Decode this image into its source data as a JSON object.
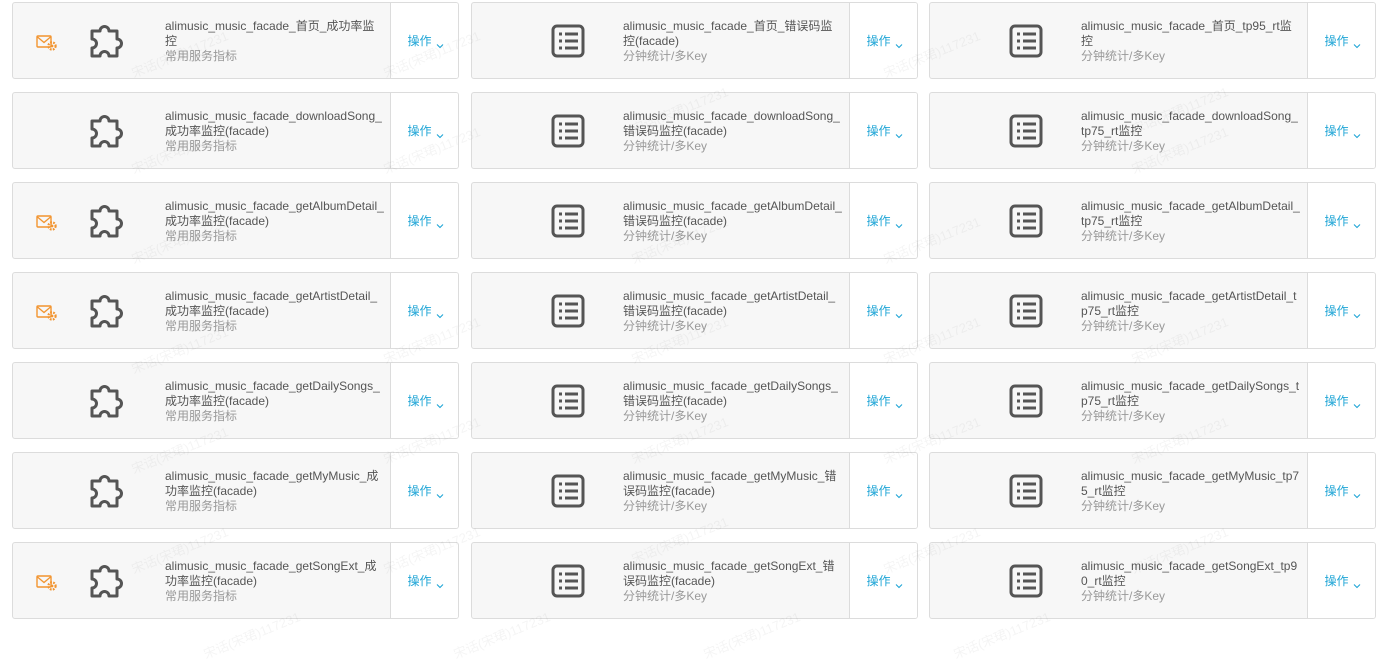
{
  "colors": {
    "accent": "#1ea5d6",
    "alert": "#f2942f",
    "icon": "#555555"
  },
  "watermark": "宋话(宋珺)117231",
  "cards": [
    {
      "name": "alimusic_music_facade_首页_成功率监控",
      "sub": "常用服务指标",
      "op": "操作",
      "kind": "service",
      "alert": true
    },
    {
      "name": "alimusic_music_facade_首页_错误码监控(facade)",
      "sub": "分钟统计/多Key",
      "op": "操作",
      "kind": "stat",
      "alert": false
    },
    {
      "name": "alimusic_music_facade_首页_tp95_rt监控",
      "sub": "分钟统计/多Key",
      "op": "操作",
      "kind": "stat",
      "alert": false
    },
    {
      "name": "alimusic_music_facade_downloadSong_成功率监控(facade)",
      "sub": "常用服务指标",
      "op": "操作",
      "kind": "service",
      "alert": false
    },
    {
      "name": "alimusic_music_facade_downloadSong_错误码监控(facade)",
      "sub": "分钟统计/多Key",
      "op": "操作",
      "kind": "stat",
      "alert": false
    },
    {
      "name": "alimusic_music_facade_downloadSong_tp75_rt监控",
      "sub": "分钟统计/多Key",
      "op": "操作",
      "kind": "stat",
      "alert": false
    },
    {
      "name": "alimusic_music_facade_getAlbumDetail_成功率监控(facade)",
      "sub": "常用服务指标",
      "op": "操作",
      "kind": "service",
      "alert": true
    },
    {
      "name": "alimusic_music_facade_getAlbumDetail_错误码监控(facade)",
      "sub": "分钟统计/多Key",
      "op": "操作",
      "kind": "stat",
      "alert": false
    },
    {
      "name": "alimusic_music_facade_getAlbumDetail_tp75_rt监控",
      "sub": "分钟统计/多Key",
      "op": "操作",
      "kind": "stat",
      "alert": false
    },
    {
      "name": "alimusic_music_facade_getArtistDetail_成功率监控(facade)",
      "sub": "常用服务指标",
      "op": "操作",
      "kind": "service",
      "alert": true
    },
    {
      "name": "alimusic_music_facade_getArtistDetail_错误码监控(facade)",
      "sub": "分钟统计/多Key",
      "op": "操作",
      "kind": "stat",
      "alert": false
    },
    {
      "name": "alimusic_music_facade_getArtistDetail_tp75_rt监控",
      "sub": "分钟统计/多Key",
      "op": "操作",
      "kind": "stat",
      "alert": false
    },
    {
      "name": "alimusic_music_facade_getDailySongs_成功率监控(facade)",
      "sub": "常用服务指标",
      "op": "操作",
      "kind": "service",
      "alert": false
    },
    {
      "name": "alimusic_music_facade_getDailySongs_错误码监控(facade)",
      "sub": "分钟统计/多Key",
      "op": "操作",
      "kind": "stat",
      "alert": false
    },
    {
      "name": "alimusic_music_facade_getDailySongs_tp75_rt监控",
      "sub": "分钟统计/多Key",
      "op": "操作",
      "kind": "stat",
      "alert": false
    },
    {
      "name": "alimusic_music_facade_getMyMusic_成功率监控(facade)",
      "sub": "常用服务指标",
      "op": "操作",
      "kind": "service",
      "alert": false
    },
    {
      "name": "alimusic_music_facade_getMyMusic_错误码监控(facade)",
      "sub": "分钟统计/多Key",
      "op": "操作",
      "kind": "stat",
      "alert": false
    },
    {
      "name": "alimusic_music_facade_getMyMusic_tp75_rt监控",
      "sub": "分钟统计/多Key",
      "op": "操作",
      "kind": "stat",
      "alert": false
    },
    {
      "name": "alimusic_music_facade_getSongExt_成功率监控(facade)",
      "sub": "常用服务指标",
      "op": "操作",
      "kind": "service",
      "alert": true
    },
    {
      "name": "alimusic_music_facade_getSongExt_错误码监控(facade)",
      "sub": "分钟统计/多Key",
      "op": "操作",
      "kind": "stat",
      "alert": false
    },
    {
      "name": "alimusic_music_facade_getSongExt_tp90_rt监控",
      "sub": "分钟统计/多Key",
      "op": "操作",
      "kind": "stat",
      "alert": false
    }
  ]
}
